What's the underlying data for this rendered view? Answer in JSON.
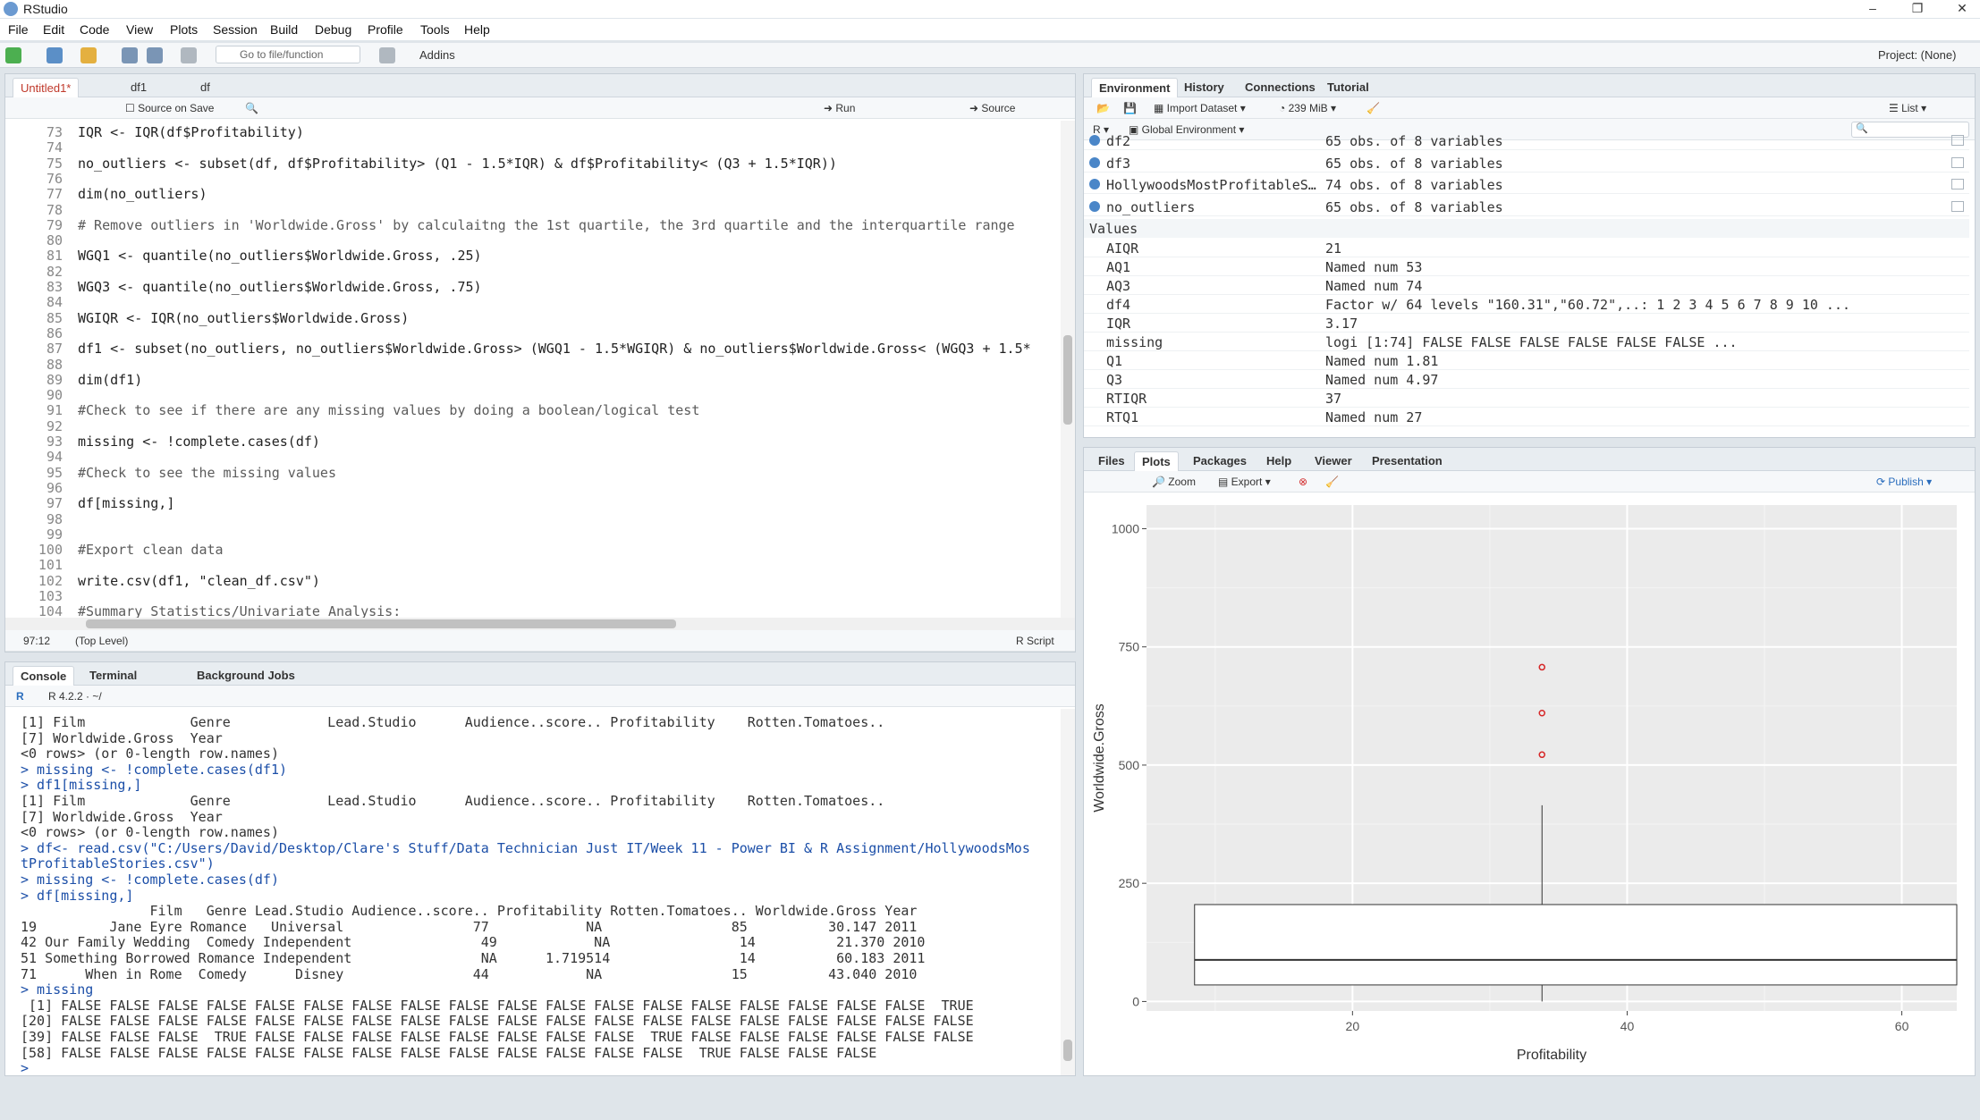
{
  "app": {
    "title": "RStudio"
  },
  "window_controls": {
    "minimize": "–",
    "maximize": "❐",
    "close": "✕"
  },
  "menu": [
    "File",
    "Edit",
    "Code",
    "View",
    "Plots",
    "Session",
    "Build",
    "Debug",
    "Profile",
    "Tools",
    "Help"
  ],
  "toolbar": {
    "goto_placeholder": "Go to file/function",
    "addins_label": "Addins",
    "project_label": "Project: (None)"
  },
  "editor": {
    "tabs": [
      "Untitled1*",
      "df1",
      "df"
    ],
    "source_on_save": "Source on Save",
    "run_label": "Run",
    "source_label": "Source",
    "cursor_pos": "97:12",
    "scope": "(Top Level)",
    "file_type": "R Script",
    "lines": [
      {
        "n": "73",
        "text": "IQR <- IQR(df$Profitability)",
        "kind": "code"
      },
      {
        "n": "74",
        "text": "",
        "kind": "code"
      },
      {
        "n": "75",
        "text": "no_outliers <- subset(df, df$Profitability> (Q1 - 1.5*IQR) & df$Profitability< (Q3 + 1.5*IQR))",
        "kind": "code"
      },
      {
        "n": "76",
        "text": "",
        "kind": "code"
      },
      {
        "n": "77",
        "text": "dim(no_outliers)",
        "kind": "code"
      },
      {
        "n": "78",
        "text": "",
        "kind": "code"
      },
      {
        "n": "79",
        "text": "# Remove outliers in 'Worldwide.Gross' by calculaitng the 1st quartile, the 3rd quartile and the interquartile range",
        "kind": "comment"
      },
      {
        "n": "80",
        "text": "",
        "kind": "code"
      },
      {
        "n": "81",
        "text": "WGQ1 <- quantile(no_outliers$Worldwide.Gross, .25)",
        "kind": "code"
      },
      {
        "n": "82",
        "text": "",
        "kind": "code"
      },
      {
        "n": "83",
        "text": "WGQ3 <- quantile(no_outliers$Worldwide.Gross, .75)",
        "kind": "code"
      },
      {
        "n": "84",
        "text": "",
        "kind": "code"
      },
      {
        "n": "85",
        "text": "WGIQR <- IQR(no_outliers$Worldwide.Gross)",
        "kind": "code"
      },
      {
        "n": "86",
        "text": "",
        "kind": "code"
      },
      {
        "n": "87",
        "text": "df1 <- subset(no_outliers, no_outliers$Worldwide.Gross> (WGQ1 - 1.5*WGIQR) & no_outliers$Worldwide.Gross< (WGQ3 + 1.5*",
        "kind": "code"
      },
      {
        "n": "88",
        "text": "",
        "kind": "code"
      },
      {
        "n": "89",
        "text": "dim(df1)",
        "kind": "code"
      },
      {
        "n": "90",
        "text": "",
        "kind": "code"
      },
      {
        "n": "91",
        "text": "#Check to see if there are any missing values by doing a boolean/logical test",
        "kind": "comment"
      },
      {
        "n": "92",
        "text": "",
        "kind": "code"
      },
      {
        "n": "93",
        "text": "missing <- !complete.cases(df)",
        "kind": "code"
      },
      {
        "n": "94",
        "text": "",
        "kind": "code"
      },
      {
        "n": "95",
        "text": "#Check to see the missing values",
        "kind": "comment"
      },
      {
        "n": "96",
        "text": "",
        "kind": "code"
      },
      {
        "n": "97",
        "text": "df[missing,]",
        "kind": "code"
      },
      {
        "n": "98",
        "text": "",
        "kind": "code"
      },
      {
        "n": "99",
        "text": "",
        "kind": "code"
      },
      {
        "n": "100",
        "text": "#Export clean data",
        "kind": "comment"
      },
      {
        "n": "101",
        "text": "",
        "kind": "code"
      },
      {
        "n": "102",
        "text": "write.csv(df1, \"clean_df.csv\")",
        "kind": "code"
      },
      {
        "n": "103",
        "text": "",
        "kind": "code"
      },
      {
        "n": "104",
        "text": "#Summary Statistics/Univariate Analysis:",
        "kind": "comment"
      },
      {
        "n": "105",
        "text": "",
        "kind": "code"
      }
    ]
  },
  "console": {
    "tabs": [
      "Console",
      "Terminal",
      "Background Jobs"
    ],
    "version": "R 4.2.2 · ~/",
    "lines": [
      {
        "text": "[1] Film             Genre            Lead.Studio      Audience..score.. Profitability    Rotten.Tomatoes..",
        "cmd": false
      },
      {
        "text": "[7] Worldwide.Gross  Year",
        "cmd": false
      },
      {
        "text": "<0 rows> (or 0-length row.names)",
        "cmd": false
      },
      {
        "text": "> missing <- !complete.cases(df1)",
        "cmd": true
      },
      {
        "text": "> df1[missing,]",
        "cmd": true
      },
      {
        "text": "[1] Film             Genre            Lead.Studio      Audience..score.. Profitability    Rotten.Tomatoes..",
        "cmd": false
      },
      {
        "text": "[7] Worldwide.Gross  Year",
        "cmd": false
      },
      {
        "text": "<0 rows> (or 0-length row.names)",
        "cmd": false
      },
      {
        "text": "> df<- read.csv(\"C:/Users/David/Desktop/Clare's Stuff/Data Technician Just IT/Week 11 - Power BI & R Assignment/HollywoodsMos",
        "cmd": true
      },
      {
        "text": "tProfitableStories.csv\")",
        "cmd": true
      },
      {
        "text": "> missing <- !complete.cases(df)",
        "cmd": true
      },
      {
        "text": "> df[missing,]",
        "cmd": true
      },
      {
        "text": "                Film   Genre Lead.Studio Audience..score.. Profitability Rotten.Tomatoes.. Worldwide.Gross Year",
        "cmd": false
      },
      {
        "text": "19         Jane Eyre Romance   Universal                77            NA                85          30.147 2011",
        "cmd": false
      },
      {
        "text": "42 Our Family Wedding  Comedy Independent                49            NA                14          21.370 2010",
        "cmd": false
      },
      {
        "text": "51 Something Borrowed Romance Independent                NA      1.719514                14          60.183 2011",
        "cmd": false
      },
      {
        "text": "71      When in Rome  Comedy      Disney                44            NA                15          43.040 2010",
        "cmd": false
      },
      {
        "text": "> missing",
        "cmd": true
      },
      {
        "text": " [1] FALSE FALSE FALSE FALSE FALSE FALSE FALSE FALSE FALSE FALSE FALSE FALSE FALSE FALSE FALSE FALSE FALSE FALSE  TRUE",
        "cmd": false
      },
      {
        "text": "[20] FALSE FALSE FALSE FALSE FALSE FALSE FALSE FALSE FALSE FALSE FALSE FALSE FALSE FALSE FALSE FALSE FALSE FALSE FALSE",
        "cmd": false
      },
      {
        "text": "[39] FALSE FALSE FALSE  TRUE FALSE FALSE FALSE FALSE FALSE FALSE FALSE FALSE  TRUE FALSE FALSE FALSE FALSE FALSE FALSE",
        "cmd": false
      },
      {
        "text": "[58] FALSE FALSE FALSE FALSE FALSE FALSE FALSE FALSE FALSE FALSE FALSE FALSE FALSE  TRUE FALSE FALSE FALSE",
        "cmd": false
      },
      {
        "text": ">",
        "cmd": true
      }
    ]
  },
  "environment": {
    "tabs": [
      "Environment",
      "History",
      "Connections",
      "Tutorial"
    ],
    "import_label": "Import Dataset",
    "memory": "239 MiB",
    "list_label": "List",
    "scope_lang": "R",
    "scope": "Global Environment",
    "data": [
      {
        "name": "df2",
        "value": "65 obs. of 8 variables"
      },
      {
        "name": "df3",
        "value": "65 obs. of 8 variables"
      },
      {
        "name": "HollywoodsMostProfitableS…",
        "value": "74 obs. of 8 variables"
      },
      {
        "name": "no_outliers",
        "value": "65 obs. of 8 variables"
      }
    ],
    "values_header": "Values",
    "values": [
      {
        "name": "AIQR",
        "value": "21"
      },
      {
        "name": "AQ1",
        "value": "Named num 53"
      },
      {
        "name": "AQ3",
        "value": "Named num 74"
      },
      {
        "name": "df4",
        "value": "Factor w/ 64 levels \"160.31\",\"60.72\",..: 1 2 3 4 5 6 7 8 9 10 ..."
      },
      {
        "name": "IQR",
        "value": "3.17"
      },
      {
        "name": "missing",
        "value": "logi [1:74] FALSE FALSE FALSE FALSE FALSE FALSE ..."
      },
      {
        "name": "Q1",
        "value": "Named num 1.81"
      },
      {
        "name": "Q3",
        "value": "Named num 4.97"
      },
      {
        "name": "RTIQR",
        "value": "37"
      },
      {
        "name": "RTQ1",
        "value": "Named num 27"
      }
    ]
  },
  "files_pane": {
    "tabs": [
      "Files",
      "Plots",
      "Packages",
      "Help",
      "Viewer",
      "Presentation"
    ],
    "zoom_label": "Zoom",
    "export_label": "Export",
    "publish_label": "Publish"
  },
  "chart_data": {
    "type": "boxplot",
    "title": "",
    "xlabel": "Profitability",
    "ylabel": "Worldwide.Gross",
    "xlim": [
      5,
      64
    ],
    "ylim": [
      -20,
      1050
    ],
    "xticks": [
      20,
      40,
      60
    ],
    "yticks": [
      0,
      250,
      500,
      750,
      1000
    ],
    "box": {
      "x_left": 8.5,
      "x_right": 64,
      "x_center": 33.8,
      "q1": 35,
      "median": 88,
      "q3": 205,
      "whisker_low": 0,
      "whisker_high": 415
    },
    "outliers": [
      {
        "x": 33.8,
        "y": 707
      },
      {
        "x": 33.8,
        "y": 610
      },
      {
        "x": 33.8,
        "y": 522
      }
    ],
    "grid": true,
    "colors": {
      "background": "#ebebeb",
      "grid": "#ffffff",
      "outlier": "#d62728"
    }
  }
}
